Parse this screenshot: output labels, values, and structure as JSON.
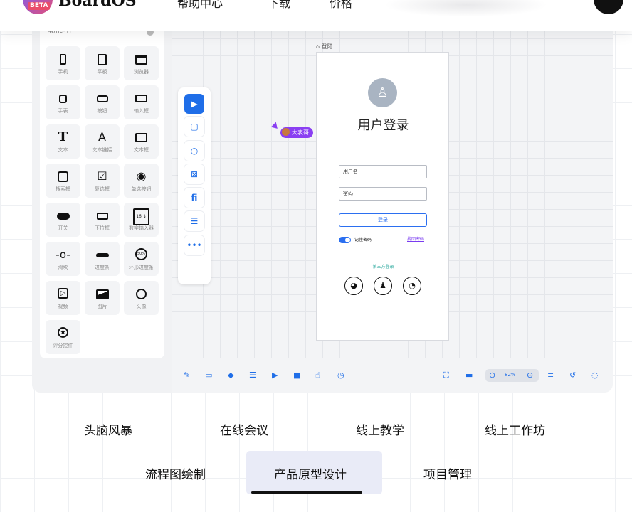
{
  "nav": {
    "brand": "BoardOS",
    "badge": "BETA",
    "links": [
      "帮助中心",
      "下载",
      "价格"
    ]
  },
  "sidebar": {
    "title": "常用组件",
    "components": [
      {
        "label": "手机",
        "icon": "phone-icon"
      },
      {
        "label": "平板",
        "icon": "tablet-icon"
      },
      {
        "label": "浏览器",
        "icon": "browser-icon"
      },
      {
        "label": "手表",
        "icon": "watch-icon"
      },
      {
        "label": "按钮",
        "icon": "button-icon"
      },
      {
        "label": "输入框",
        "icon": "input-icon"
      },
      {
        "label": "文本",
        "icon": "text-icon"
      },
      {
        "label": "文本链接",
        "icon": "text-link-icon"
      },
      {
        "label": "文本框",
        "icon": "textbox-icon"
      },
      {
        "label": "搜索框",
        "icon": "search-box-icon"
      },
      {
        "label": "复选框",
        "icon": "checkbox-icon"
      },
      {
        "label": "单选按钮",
        "icon": "radio-icon"
      },
      {
        "label": "开关",
        "icon": "toggle-icon"
      },
      {
        "label": "下拉框",
        "icon": "dropdown-icon"
      },
      {
        "label": "数字输入器",
        "icon": "number-input-icon"
      },
      {
        "label": "滑块",
        "icon": "slider-icon"
      },
      {
        "label": "进度条",
        "icon": "progress-icon"
      },
      {
        "label": "环形进度条",
        "icon": "ring-progress-icon"
      },
      {
        "label": "视频",
        "icon": "video-icon"
      },
      {
        "label": "图片",
        "icon": "image-icon"
      },
      {
        "label": "头像",
        "icon": "avatar-icon"
      },
      {
        "label": "评分控件",
        "icon": "rating-icon"
      }
    ],
    "glyphs": {
      "text": "T",
      "text_link": "A",
      "number_input": "16 ↕",
      "ring_progress": "50%"
    }
  },
  "canvas": {
    "collaborator": "大表哥",
    "frame_label": "登陆",
    "login": {
      "title": "用户登录",
      "username": "用户名",
      "password": "密码",
      "login_button": "登录",
      "remember": "记住密码",
      "forgot": "找回密码",
      "third_party": "第三方登录"
    },
    "zoom": "82%"
  },
  "feature_tabs": [
    "头脑风暴",
    "在线会议",
    "线上教学",
    "线上工作坊",
    "流程图绘制",
    "产品原型设计",
    "项目管理"
  ],
  "active_tab": "产品原型设计",
  "colors": {
    "accent": "#1f6ee8",
    "collaborator": "#8a3ff2",
    "link": "#7a3cf0",
    "third_party": "#23a69a"
  }
}
